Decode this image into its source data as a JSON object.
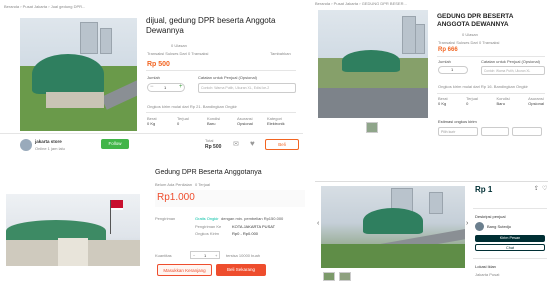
{
  "panel1": {
    "breadcrumb": "Beranda › Pusat Jakarta › Jual gedung DPR...",
    "title": "dijual, gedung DPR beserta Anggota Dewannya",
    "sold": "0 Ulasan",
    "seller_line": "Transaksi Sukses Dari 0 Transaksi",
    "wishlist": "Tambahkan",
    "price": "Rp 500",
    "qty_label": "Jumlah",
    "qty_value": "1",
    "note_label": "Catatan untuk Penjual (Opsional)",
    "note_placeholder": "Contoh: Warna Putih, Ukuran XL, Edisi ke-2",
    "shipping": "Ongkos kirim mulai dari Rp 21.  Bandingkan Ongkir",
    "info": [
      {
        "label": "Berat",
        "value": "0 Kg"
      },
      {
        "label": "Terjual",
        "value": "0"
      },
      {
        "label": "Kondisi",
        "value": "Baru"
      },
      {
        "label": "Asuransi",
        "value": "Opsional"
      },
      {
        "label": "Kategori",
        "value": "Elektronik"
      }
    ],
    "shop_name": "jakarta store",
    "shop_sub": "Online 1 jam lalu",
    "follow_label": "Follow",
    "total_label": "Total",
    "total_value": "Rp 500",
    "buy_label": "Beli"
  },
  "panel2": {
    "breadcrumb": "Beranda › Pusat Jakarta › GEDUNG DPR BESER...",
    "title": "GEDUNG DPR BESERTA ANGGOTA DEWANNYA",
    "sold": "0 Ulasan",
    "seller_line": "Transaksi Sukses Dari 0 Transaksi",
    "price": "Rp 666",
    "qty_label": "Jumlah",
    "qty_value": "1",
    "note_label": "Catatan untuk Penjual (Opsional)",
    "note_placeholder": "Contoh: Warna Putih, Ukuran XL",
    "shipping": "Ongkos kirim mulai dari Rp 16.  Bandingkan Ongkir",
    "info": [
      {
        "label": "Berat",
        "value": "0 Kg"
      },
      {
        "label": "Terjual",
        "value": "0"
      },
      {
        "label": "Kondisi",
        "value": "Baru"
      },
      {
        "label": "Asuransi",
        "value": "Opsional"
      }
    ],
    "calc_label": "Estimasi ongkos kirim",
    "select_placeholder": "Pilih kurir"
  },
  "panel3": {
    "title": "Gedung DPR Beserta Anggotanya",
    "reviews": "Belum Ada Penilaian",
    "sold": "0 Terjual",
    "price": "Rp1.000",
    "shipping_label": "Pengiriman",
    "free_label": "Gratis Ongkir",
    "free_text": "dengan min. pembelian Rp150.000",
    "ship_to_label": "Pengiriman Ke",
    "ship_to_value": "KOTA JAKARTA PUSAT",
    "ongkir_label": "Ongkos Kirim",
    "ongkir_value": "Rp0 - Rp0.000",
    "qty_label": "Kuantitas",
    "qty_value": "1",
    "stock": "tersisa 10000 buah",
    "cart_label": "Masukkan Keranjang",
    "buy_label": "Beli Sekarang"
  },
  "panel4": {
    "price": "Rp 1",
    "seller_section": "Deskripsi penjual",
    "seller_name": "Bang Sutedjo",
    "contact_label": "Kirim Pesan",
    "chat_label": "Chat",
    "location_label": "Lokasi iklan",
    "location_value": "Jakarta Pusat"
  },
  "colors": {
    "tokopedia_green": "#42b549",
    "shopee_orange": "#ee4d2d",
    "bukalapak_red": "#e31e52",
    "olx_navy": "#002f34"
  }
}
